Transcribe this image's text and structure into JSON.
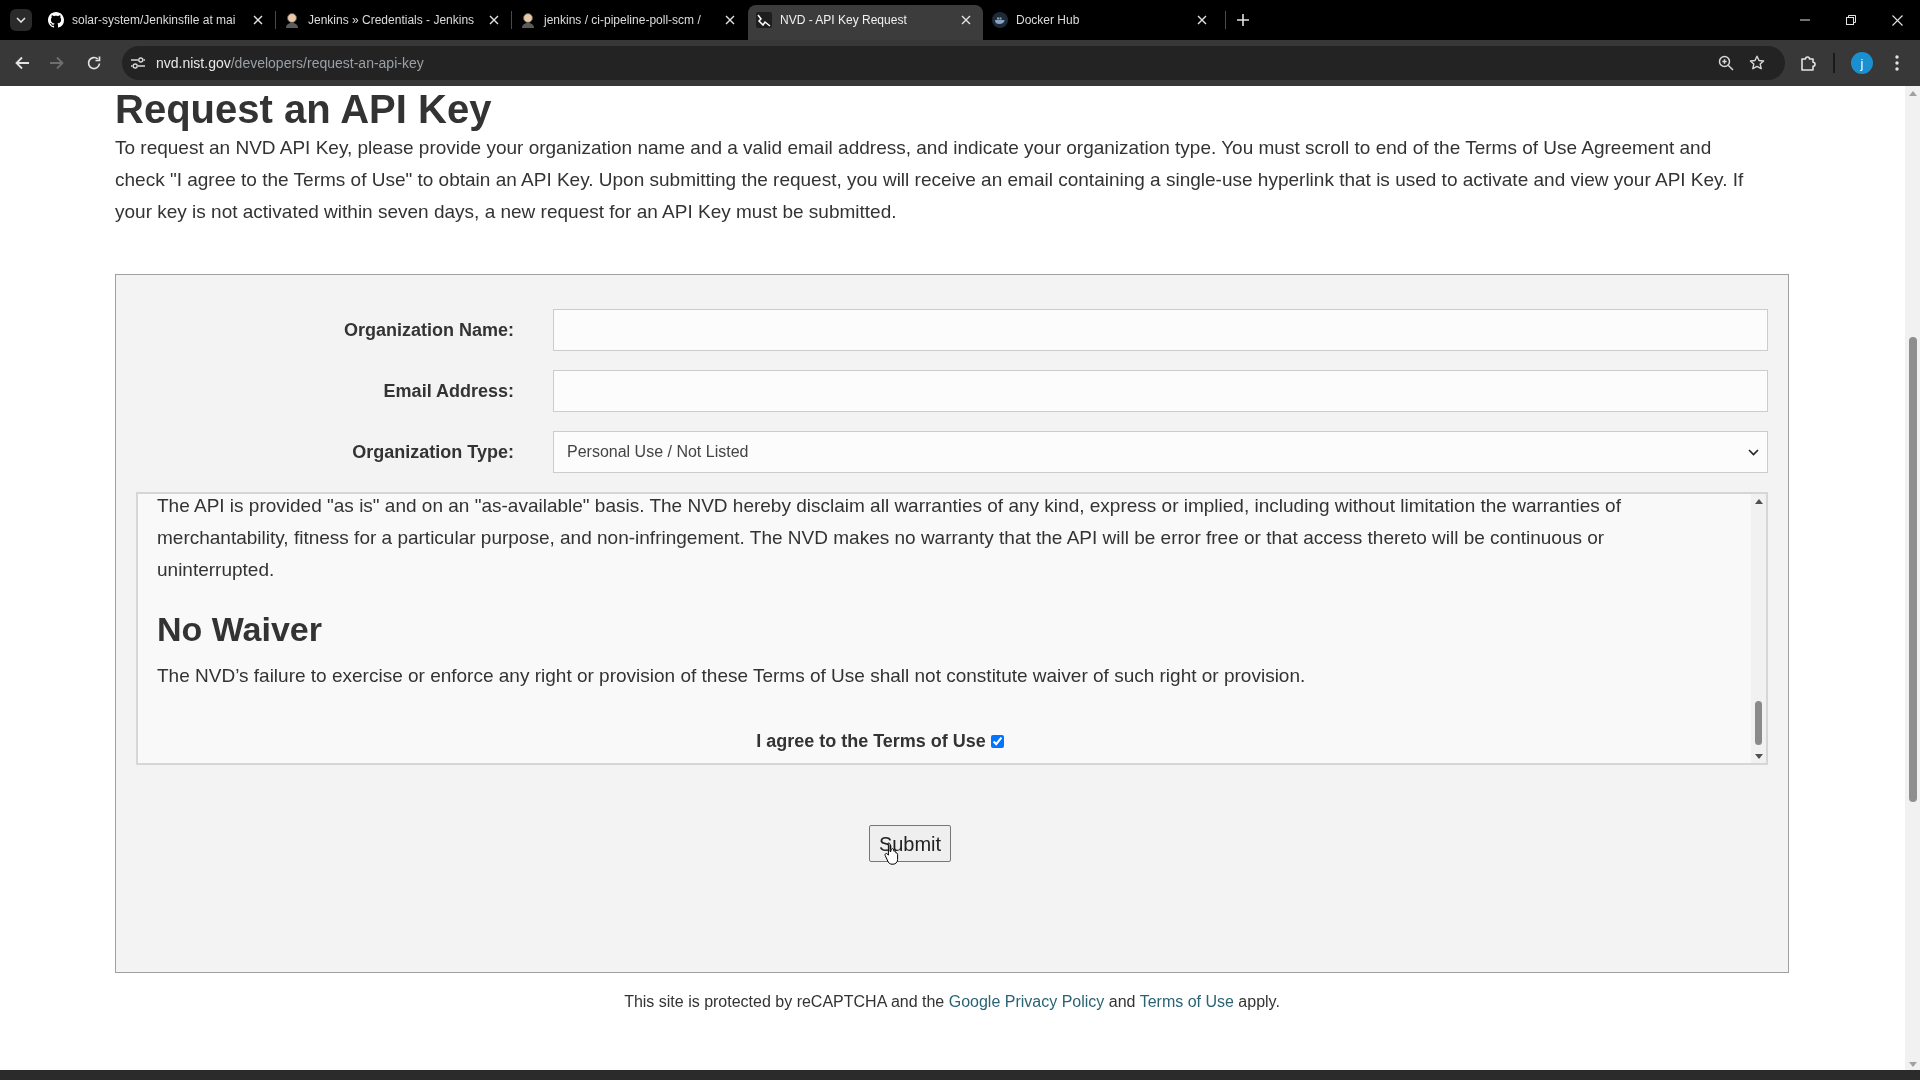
{
  "browser": {
    "tabs": [
      {
        "kind": "github",
        "title": "solar-system/Jenkinsfile at mai",
        "selected": false
      },
      {
        "kind": "jenkins",
        "title": "Jenkins » Credentials - Jenkins",
        "selected": false
      },
      {
        "kind": "jenkins",
        "title": "jenkins / ci-pipeline-poll-scm /",
        "selected": false
      },
      {
        "kind": "nvd",
        "title": "NVD - API Key Request",
        "selected": true
      },
      {
        "kind": "docker",
        "title": "Docker Hub",
        "selected": false
      }
    ],
    "nav_buttons": [
      {
        "kind": "back",
        "disabled": false
      },
      {
        "kind": "forward",
        "disabled": true
      },
      {
        "kind": "reload",
        "disabled": false
      }
    ],
    "address_bar": {
      "host": "nvd.nist.gov",
      "path": "/developers/request-an-api-key"
    },
    "profile": {
      "initial": "j"
    }
  },
  "page": {
    "title": "Request an API Key",
    "intro": "To request an NVD API Key, please provide your organization name and a valid email address, and indicate your organization type. You must scroll to end of the Terms of Use Agreement and check \"I agree to the Terms of Use\" to obtain an API Key. Upon submitting the request, you will receive an email containing a single-use hyperlink that is used to activate and view your API Key. If your key is not activated within seven days, a new request for an API Key must be submitted.",
    "form": {
      "fields": [
        {
          "kind": "text",
          "label": "Organization Name:"
        },
        {
          "kind": "text",
          "label": "Email Address:"
        },
        {
          "kind": "select",
          "label": "Organization Type:",
          "value": "Personal Use / Not Listed"
        }
      ],
      "terms": {
        "content": [
          {
            "kind": "paragraph",
            "text": "The API is provided \"as is\" and on an \"as-available\" basis. The NVD hereby disclaim all warranties of any kind, express or implied, including without limitation the warranties of merchantability, fitness for a particular purpose, and non-infringement. The NVD makes no warranty that the API will be error free or that access thereto will be continuous or uninterrupted."
          },
          {
            "kind": "heading",
            "text": "No Waiver"
          },
          {
            "kind": "paragraph",
            "text": "The NVD’s failure to exercise or enforce any right or provision of these Terms of Use shall not constitute waiver of such right or provision."
          }
        ],
        "agree": {
          "label": "I agree to the Terms of Use",
          "checked": true
        }
      },
      "submit": {
        "label": "Submit"
      }
    },
    "footer": {
      "parts": [
        {
          "kind": "text",
          "text": "This site is protected by reCAPTCHA and the"
        },
        {
          "kind": "link",
          "text": "Google Privacy Policy"
        },
        {
          "kind": "text",
          "text": "and"
        },
        {
          "kind": "link",
          "text": "Terms of Use"
        },
        {
          "kind": "text",
          "text": "apply."
        }
      ]
    }
  }
}
